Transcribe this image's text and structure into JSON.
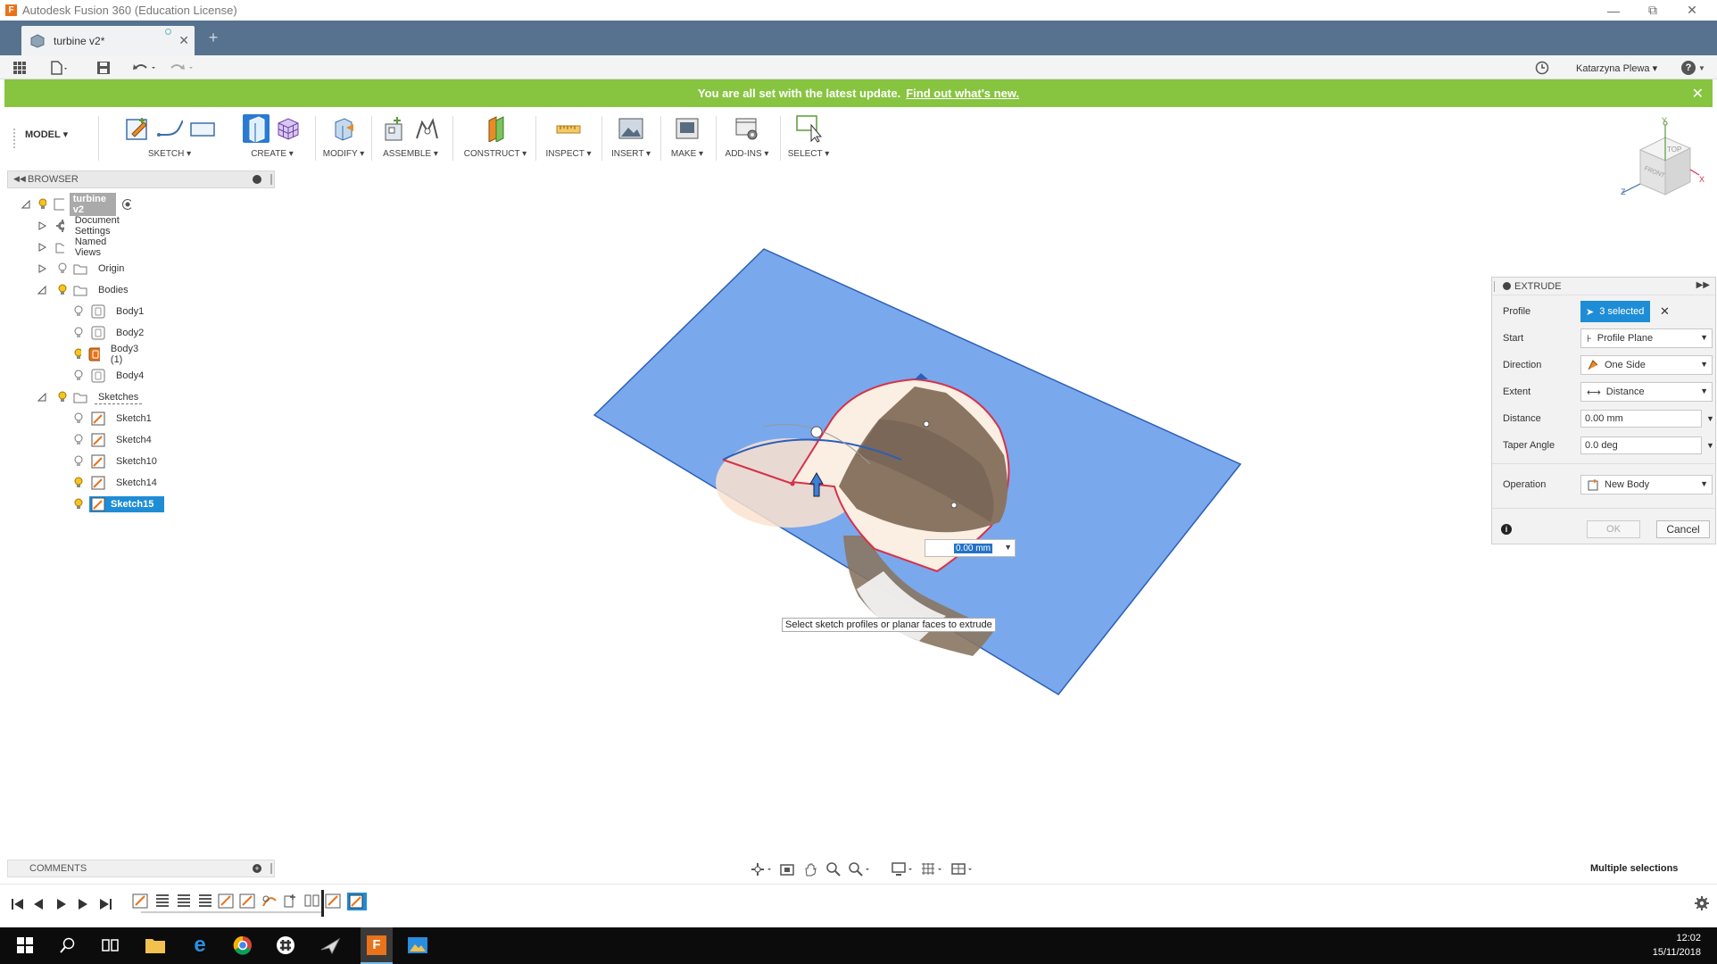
{
  "app": {
    "title": "Autodesk Fusion 360 (Education License)",
    "icon_letter": "F",
    "accent": "#57728f"
  },
  "tab": {
    "label": "turbine v2*",
    "add": "+"
  },
  "user": {
    "name": "Katarzyna Plewa ▾"
  },
  "help": "?",
  "banner": {
    "text": "You are all set with the latest update.",
    "link": "Find out what's new.",
    "color": "#87c440"
  },
  "toolbar": {
    "workspace": "MODEL ▾",
    "groups": {
      "sketch": "SKETCH ▾",
      "create": "CREATE ▾",
      "modify": "MODIFY ▾",
      "assemble": "ASSEMBLE ▾",
      "construct": "CONSTRUCT ▾",
      "inspect": "INSPECT ▾",
      "insert": "INSERT ▾",
      "make": "MAKE ▾",
      "addins": "ADD-INS ▾",
      "select": "SELECT ▾"
    }
  },
  "browser": {
    "title": "BROWSER",
    "root": "turbine v2",
    "items": {
      "doc_settings": "Document Settings",
      "named_views": "Named Views",
      "origin": "Origin",
      "bodies": "Bodies",
      "body1": "Body1",
      "body2": "Body2",
      "body3": "Body3 (1)",
      "body4": "Body4",
      "sketches": "Sketches",
      "sketch1": "Sketch1",
      "sketch4": "Sketch4",
      "sketch10": "Sketch10",
      "sketch14": "Sketch14",
      "sketch15": "Sketch15"
    }
  },
  "comments": {
    "title": "COMMENTS"
  },
  "viewcube": {
    "top": "TOP",
    "front": "FRONT",
    "x": "X",
    "y": "Y",
    "z": "Z"
  },
  "canvas": {
    "tooltip": "Select sketch profiles or planar faces to extrude",
    "dimension": "0.00 mm"
  },
  "extrude": {
    "title": "EXTRUDE",
    "profile_label": "Profile",
    "profile_value": "3 selected",
    "start_label": "Start",
    "start_value": "Profile Plane",
    "direction_label": "Direction",
    "direction_value": "One Side",
    "extent_label": "Extent",
    "extent_value": "Distance",
    "distance_label": "Distance",
    "distance_value": "0.00 mm",
    "taper_label": "Taper Angle",
    "taper_value": "0.0 deg",
    "operation_label": "Operation",
    "operation_value": "New Body",
    "ok": "OK",
    "cancel": "Cancel"
  },
  "status": {
    "multiple": "Multiple selections"
  },
  "clock": {
    "time": "12:02",
    "date": "15/11/2018"
  }
}
